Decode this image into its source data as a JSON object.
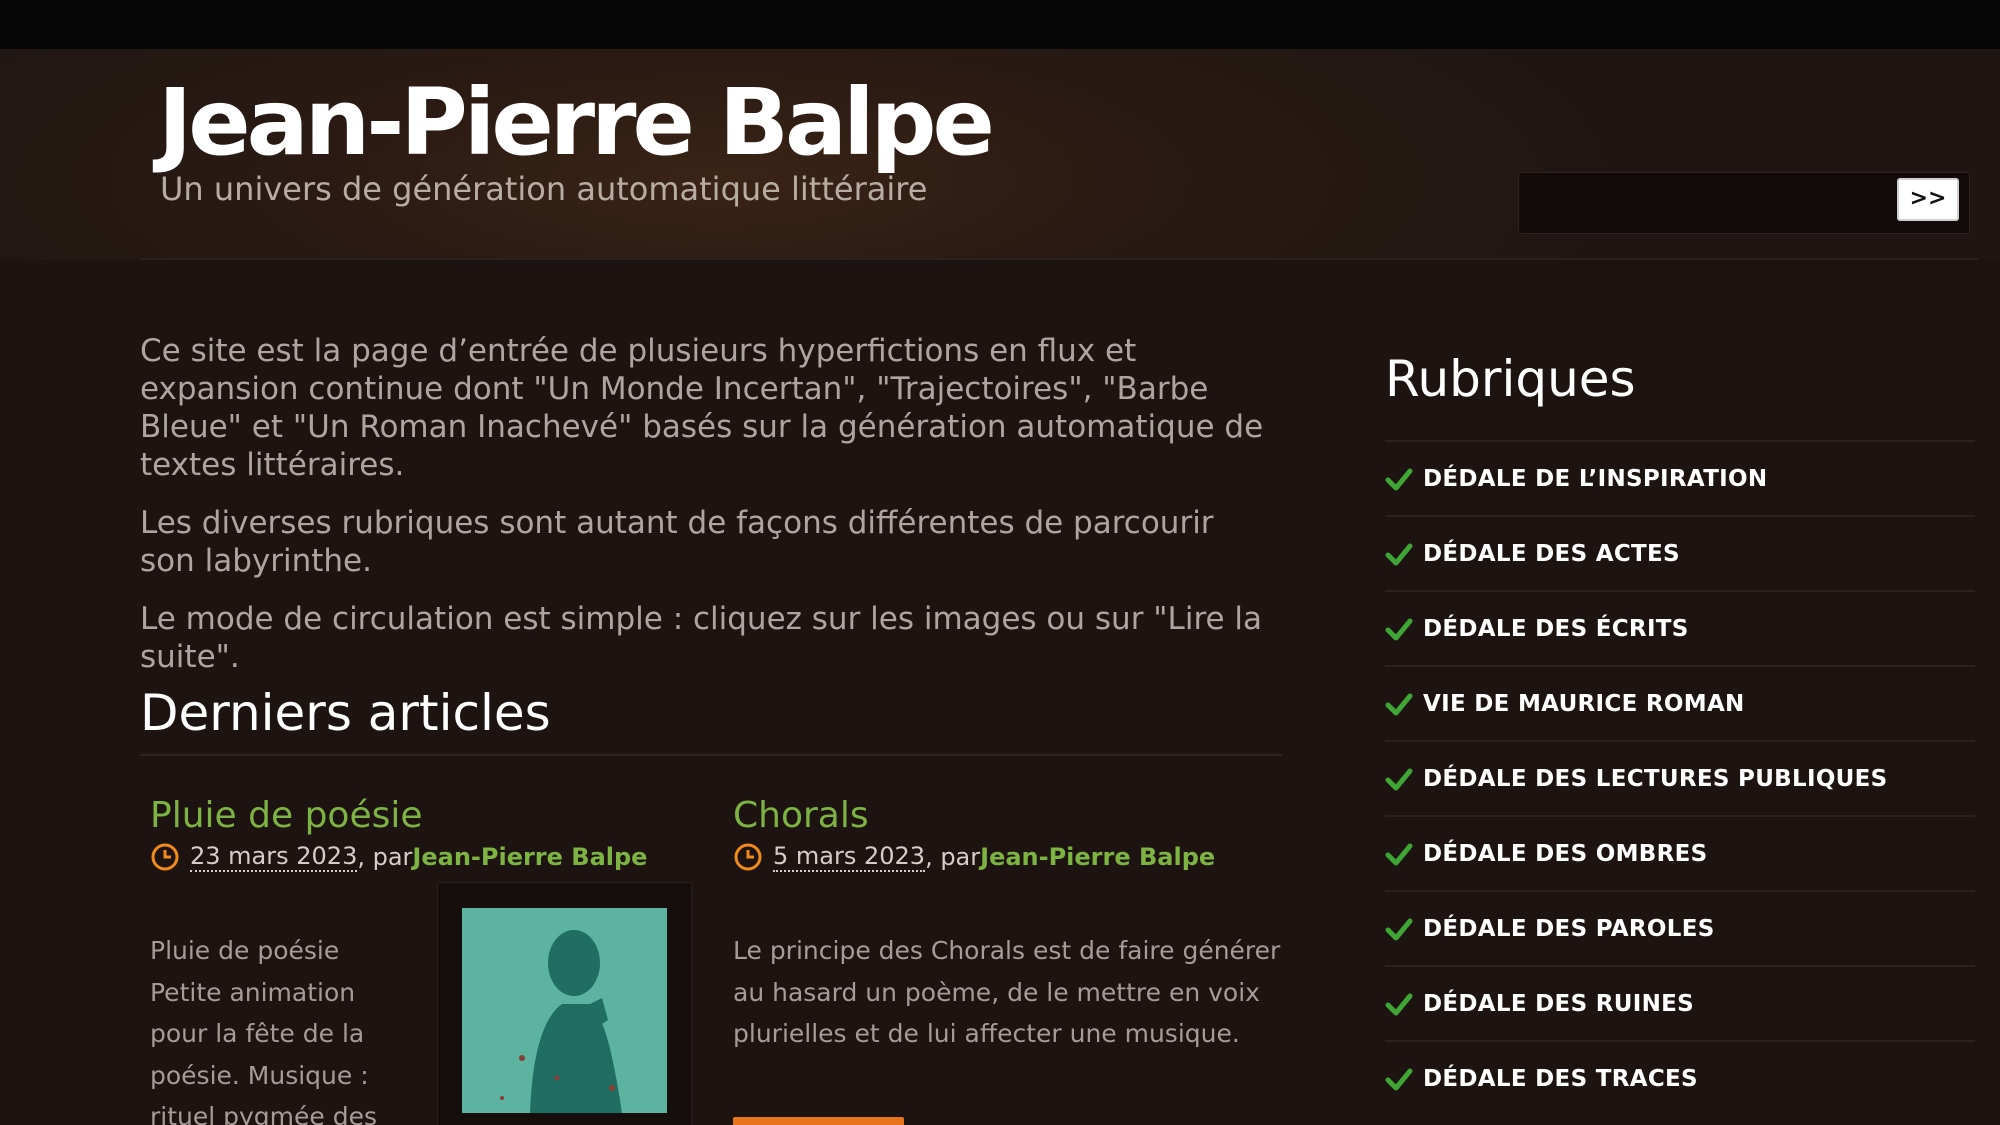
{
  "header": {
    "site_title": "Jean-Pierre Balpe",
    "tagline": "Un univers de génération automatique littéraire",
    "search": {
      "value": "",
      "button_label": ">>"
    }
  },
  "intro": {
    "paragraphs": [
      "Ce site est la page d’entrée de plusieurs hyperfictions en flux et expansion continue dont \"Un Monde Incertan\", \"Trajectoires\", \"Barbe Bleue\" et \"Un Roman Inachevé\" basés sur la génération automatique de textes littéraires.",
      "Les diverses rubriques sont autant de façons différentes de parcourir son labyrinthe.",
      "Le mode de circulation est simple : cliquez sur les images ou sur \"Lire la suite\"."
    ]
  },
  "latest": {
    "title": "Derniers articles",
    "articles": [
      {
        "title": "Pluie de poésie",
        "date": "23 mars 2023",
        "by": ", par ",
        "author": "Jean-Pierre Balpe",
        "excerpt_lines": [
          "Pluie de poésie",
          "Petite animation",
          "pour la fête de la",
          "poésie. Musique :",
          "rituel pygmée des"
        ]
      },
      {
        "title": "Chorals",
        "date": "5 mars 2023",
        "by": ", par ",
        "author": "Jean-Pierre Balpe",
        "excerpt_lines": [
          "Le principe des Chorals est de faire générer",
          "au hasard un poème, de le mettre en voix",
          "plurielles et de lui affecter une musique."
        ]
      }
    ]
  },
  "sidebar": {
    "title": "Rubriques",
    "items": [
      {
        "label": "DÉDALE DE L’INSPIRATION"
      },
      {
        "label": "DÉDALE DES ACTES"
      },
      {
        "label": "DÉDALE DES ÉCRITS"
      },
      {
        "label": "VIE DE MAURICE ROMAN"
      },
      {
        "label": "DÉDALE DES LECTURES PUBLIQUES"
      },
      {
        "label": "DÉDALE DES OMBRES"
      },
      {
        "label": "DÉDALE DES PAROLES"
      },
      {
        "label": "DÉDALE DES RUINES"
      },
      {
        "label": "DÉDALE DES TRACES"
      }
    ]
  },
  "colors": {
    "background": "#1d1412",
    "accent_green": "#7cb342",
    "clock_orange": "#f08a1c",
    "button_orange": "#e8741c",
    "check_green": "#3fa535"
  },
  "icons": {
    "clock": "clock-icon",
    "check": "check-icon",
    "thumbnail": "shadow-silhouette-photo"
  }
}
